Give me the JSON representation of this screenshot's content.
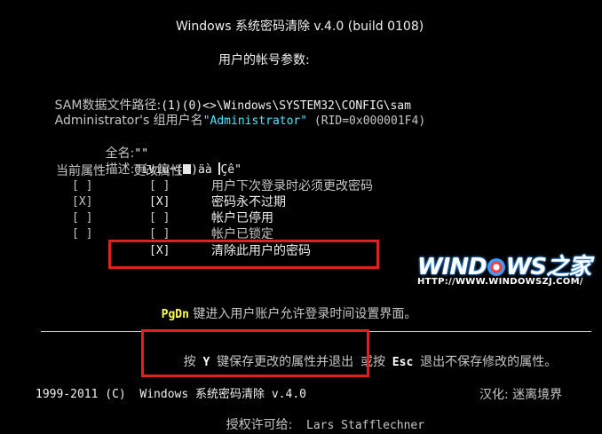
{
  "header": {
    "title": "Windows 系统密码清除 v.4.0 (build 0108)",
    "subtitle": "用户的帐号参数:"
  },
  "sam": {
    "path_label": "SAM数据文件路径:",
    "path_value": "(1)(0)<>\\Windows\\SYSTEM32\\CONFIG\\sam",
    "admin_prefix": "Administrator's 组用户名",
    "admin_name": "\"Administrator\"",
    "rid": " (RID=0x000001F4)"
  },
  "info": {
    "fullname_label": "全名:",
    "fullname_value": "\"\"",
    "desc_label": "描述:",
    "desc_value_a": "\"ívíù¬(",
    "desc_value_b": ")äà ",
    "desc_value_c": "Çê\""
  },
  "columns": {
    "current": "当前属性",
    "change": "更改属性"
  },
  "attributes": [
    {
      "current": "[ ]",
      "change": "[ ]",
      "label": "用户下次登录时必须更改密码"
    },
    {
      "current": "[X]",
      "change": "[X]",
      "label": "密码永不过期"
    },
    {
      "current": "[ ]",
      "change": "[ ]",
      "label": "帐户已停用"
    },
    {
      "current": "[ ]",
      "change": "[ ]",
      "label": "帐户已锁定"
    },
    {
      "current": "",
      "change": "[X]",
      "label": "清除此用户的密码"
    }
  ],
  "pgdn": {
    "key": "PgDn",
    "text": " 键进入用户账户允许登录时间设置界面。"
  },
  "footer_action": {
    "press": "按",
    "key_y": "Y",
    "save_text": "键保存更改的属性并退出",
    "or_text": "或按",
    "key_esc": "Esc",
    "quit_text": "退出不保存修改的属性。"
  },
  "credits": {
    "copyright": "1999-2011 (C)  Windows 系统密码清除 v.4.0",
    "localized": "汉化: 迷离境界",
    "license_label": "授权许可给:",
    "license_name": "Lars Stafflechner"
  },
  "watermark": {
    "left": "WIND",
    "right": "WS之家",
    "url": "HTTP://WWW.WINDOWSZJ.COM/"
  },
  "colors": {
    "background": "#000000",
    "text": "#c6c6c6",
    "highlight_cyan": "#55e6ff",
    "key_yellow": "#ffff55",
    "annotation_red": "#e02020"
  }
}
